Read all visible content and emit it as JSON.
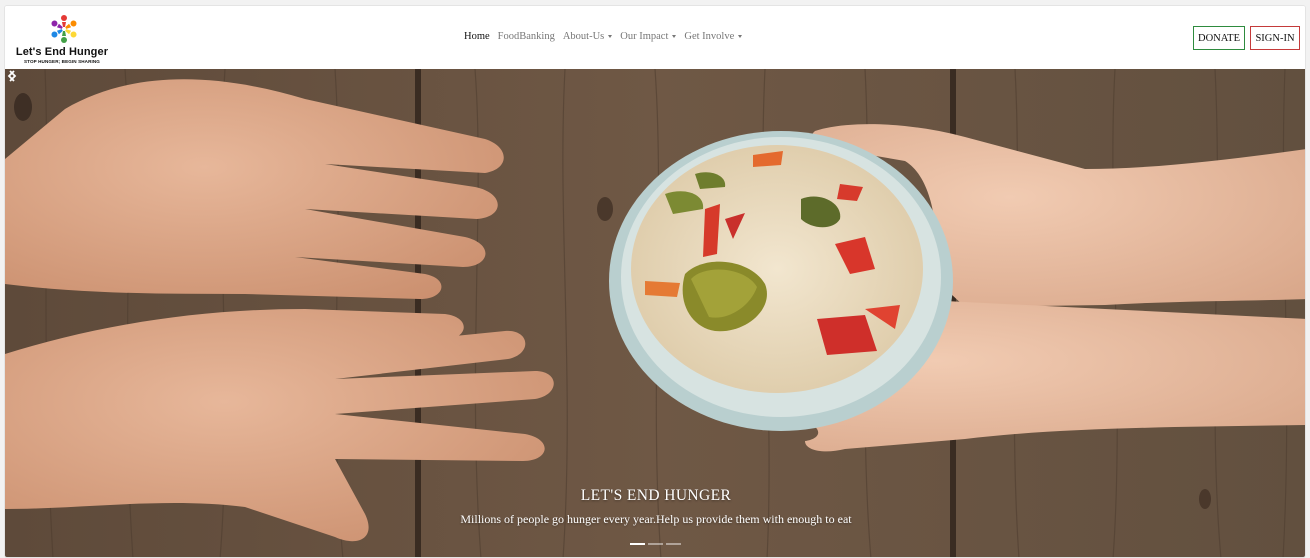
{
  "brand": {
    "title": "Let's End Hunger",
    "tagline": "STOP HUNGER; BEGIN SHARING",
    "icon": "people-circle-logo"
  },
  "nav": {
    "items": [
      {
        "label": "Home",
        "active": true,
        "dropdown": false
      },
      {
        "label": "FoodBanking",
        "active": false,
        "dropdown": false
      },
      {
        "label": "About-Us",
        "active": false,
        "dropdown": true
      },
      {
        "label": "Our Impact",
        "active": false,
        "dropdown": true
      },
      {
        "label": "Get Involve",
        "active": false,
        "dropdown": true
      }
    ]
  },
  "actions": {
    "donate_label": "DONATE",
    "signin_label": "SIGN-IN"
  },
  "hero": {
    "title": "LET'S END HUNGER",
    "subtitle": "Millions of people go hunger every year.Help us provide them with enough to eat",
    "slides": 3,
    "active_slide": 0
  },
  "colors": {
    "donate_border": "#2e8b3e",
    "signin_border": "#c43a3a",
    "wood": "#6f5845"
  }
}
